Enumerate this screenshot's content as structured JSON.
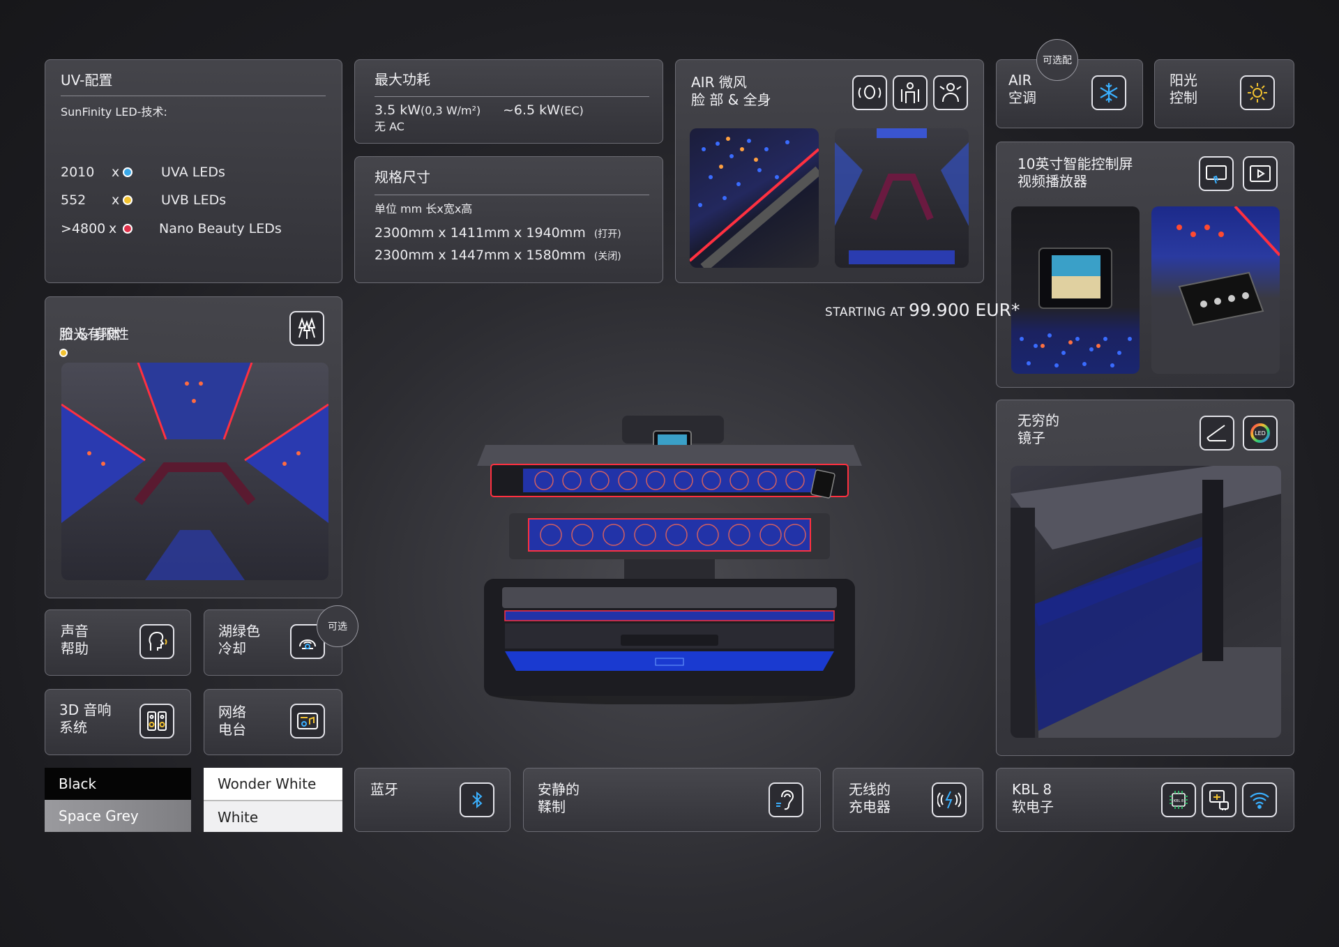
{
  "uv_config": {
    "title": "UV-配置",
    "subtitle": "SunFinity LED-技术:",
    "rows": [
      {
        "count": "2010",
        "x": "x",
        "label": "UVA LEDs",
        "color": "#3aa8e8"
      },
      {
        "count": "552",
        "x": "x",
        "label": "UVB LEDs",
        "color": "#f2c230"
      },
      {
        "count": ">4800",
        "x": "x",
        "label": "Nano Beauty LEDs",
        "color": "#e0304a"
      }
    ]
  },
  "power": {
    "title": "最大功耗",
    "line1": "3.5 kW",
    "line1_small": "(0,3 W/m²)",
    "line1b": "~6.5 kW",
    "line1b_small": "(EC)",
    "line2": "无 AC"
  },
  "dimensions": {
    "title": "规格尺寸",
    "unit": "单位 mm 长x宽x高",
    "row1": "2300mm x 1411mm x 1940mm",
    "row1_note": "(打开)",
    "row2": "2300mm x 1447mm x 1580mm",
    "row2_note": "(关闭)"
  },
  "air": {
    "title": "AIR 微风\n脸 部 & 全身",
    "icons": [
      "face-fan-icon",
      "body-fan-icon",
      "full-body-fan-icon"
    ]
  },
  "air_con": {
    "title": "AIR\n空调",
    "badge": "可选配",
    "icon": "snowflake-icon"
  },
  "sun_control": {
    "title": "阳光\n控制",
    "icon": "sun-gear-icon"
  },
  "screen": {
    "title": "10英寸智能控制屏\n视频播放器",
    "icons": [
      "touchscreen-icon",
      "video-player-icon"
    ]
  },
  "price": {
    "prefix": "STARTING AT",
    "value": "99.900 EUR*"
  },
  "sun_limited": {
    "title_line1": "阳光有限性",
    "title_line2": "脸  & 身体",
    "dot_colors": [
      "#f2c230",
      "#e0304a",
      "#3aa8e8"
    ],
    "icon": "spotlight-icon"
  },
  "infinite_mirror": {
    "title": "无穷的\n镜子",
    "icons": [
      "mirror-icon",
      "led-ring-icon"
    ],
    "led_text": "LED"
  },
  "features": {
    "voice_help": {
      "title": "声音\n帮助",
      "icon": "voice-head-icon"
    },
    "aqua_cool": {
      "title": "湖绿色\n冷却",
      "badge": "可选",
      "icon": "aqua-cooling-icon"
    },
    "sound3d": {
      "title": "3D 音响\n系统",
      "icon": "speakers-icon"
    },
    "radio": {
      "title": "网络\n电台",
      "icon": "web-radio-icon"
    },
    "bluetooth": {
      "title": "蓝牙",
      "icon": "bluetooth-icon"
    },
    "quiet": {
      "title": "安静的\n鞣制",
      "icon": "ear-icon"
    },
    "wireless": {
      "title": "无线的\n充电器",
      "icon": "wireless-charge-icon"
    },
    "kbl": {
      "title": "KBL 8\n软电子",
      "icons": [
        "chip-icon",
        "network-icon",
        "wifi-icon"
      ],
      "chip_text": "KBL 8"
    }
  },
  "colors": [
    {
      "top": "Black",
      "bottom": "Space Grey",
      "top_bg": "#050505",
      "bottom_bg": "#8a8a8e"
    },
    {
      "top": "Wonder White",
      "bottom": "White",
      "top_bg": "#ffffff",
      "bottom_bg": "#f2f2f4"
    }
  ]
}
